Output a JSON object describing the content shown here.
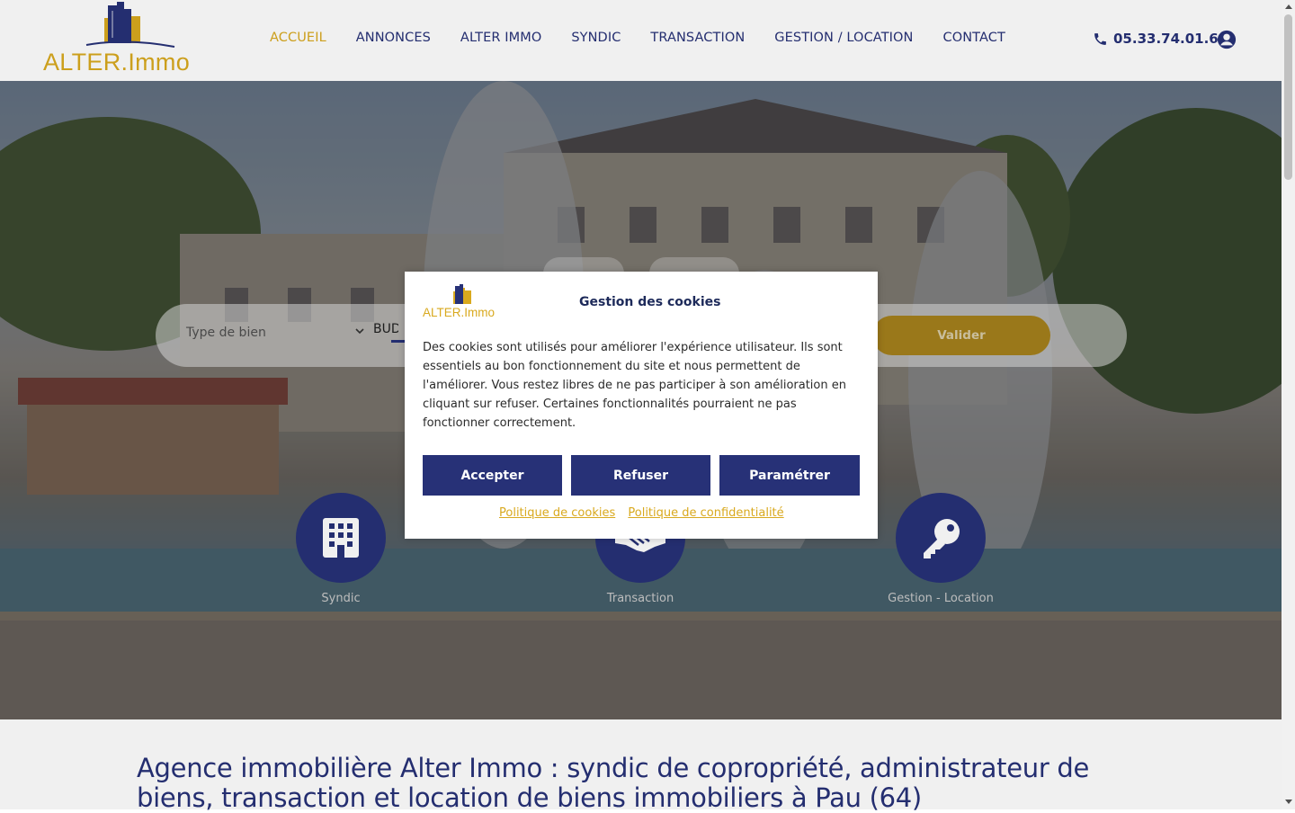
{
  "brand": {
    "logo_text": "ALTER.Immo",
    "primary_color": "#273177",
    "accent_color": "#d9a91e"
  },
  "nav": {
    "items": [
      {
        "label": "ACCUEIL",
        "active": true
      },
      {
        "label": "ANNONCES",
        "active": false
      },
      {
        "label": "ALTER IMMO",
        "active": false
      },
      {
        "label": "SYNDIC",
        "active": false
      },
      {
        "label": "TRANSACTION",
        "active": false
      },
      {
        "label": "GESTION / LOCATION",
        "active": false
      },
      {
        "label": "CONTACT",
        "active": false
      }
    ],
    "phone": "05.33.74.01.60"
  },
  "search": {
    "type_placeholder": "Type de bien",
    "budget_label": "BUDG",
    "submit_label": "Valider"
  },
  "services": [
    {
      "label": "Syndic",
      "icon": "building-icon"
    },
    {
      "label": "Transaction",
      "icon": "handshake-icon"
    },
    {
      "label": "Gestion - Location",
      "icon": "key-icon"
    }
  ],
  "content": {
    "title": "Agence immobilière Alter Immo : syndic de copropriété, administrateur de biens, transaction et location de biens immobiliers à Pau (64)"
  },
  "cookie_modal": {
    "logo_text": "ALTER.Immo",
    "title": "Gestion des cookies",
    "text": "Des cookies sont utilisés pour améliorer l'expérience utilisateur. Ils sont essentiels au bon fonctionnement du site et nous permettent de l'améliorer. Vous restez libres de ne pas participer à son amélioration en cliquant sur refuser.  Certaines fonctionnalités pourraient ne pas fonctionner correctement.",
    "accept_label": "Accepter",
    "refuse_label": "Refuser",
    "settings_label": "Paramétrer",
    "cookie_policy_label": "Politique de cookies",
    "privacy_policy_label": "Politique de confidentialité"
  }
}
